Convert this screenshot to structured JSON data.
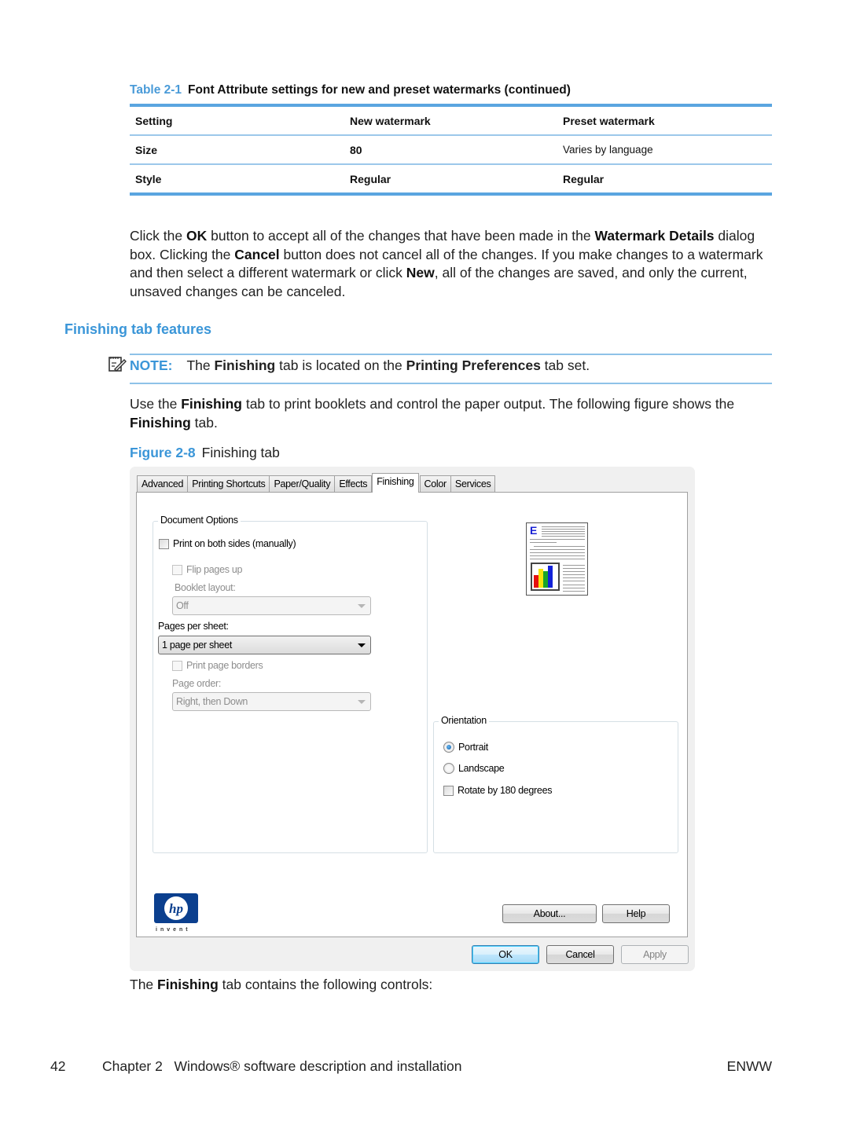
{
  "table": {
    "caption_number": "Table 2-1",
    "caption_title": "Font Attribute settings for new and preset watermarks (continued)",
    "headers": [
      "Setting",
      "New watermark",
      "Preset watermark"
    ],
    "rows": [
      [
        "Size",
        "80",
        "Varies by language"
      ],
      [
        "Style",
        "Regular",
        "Regular"
      ]
    ]
  },
  "paragraph1": {
    "t1": "Click the ",
    "b1": "OK",
    "t2": " button to accept all of the changes that have been made in the ",
    "b2": "Watermark Details",
    "t3": " dialog box. Clicking the ",
    "b3": "Cancel",
    "t4": " button does not cancel all of the changes. If you make changes to a watermark and then select a different watermark or click ",
    "b4": "New",
    "t5": ", all of the changes are saved, and only the current, unsaved changes can be canceled."
  },
  "section": {
    "title": "Finishing tab features"
  },
  "note": {
    "label": "NOTE:",
    "t1": "The ",
    "b1": "Finishing",
    "t2": " tab is located on the ",
    "b2": "Printing Preferences",
    "t3": " tab set."
  },
  "paragraph2": {
    "t1": "Use the ",
    "b1": "Finishing",
    "t2": " tab to print booklets and control the paper output. The following figure shows the ",
    "b2": "Finishing",
    "t3": " tab."
  },
  "figure": {
    "number": "Figure 2-8",
    "title": "Finishing tab"
  },
  "dialog": {
    "tabs": [
      "Advanced",
      "Printing Shortcuts",
      "Paper/Quality",
      "Effects",
      "Finishing",
      "Color",
      "Services"
    ],
    "active_tab": "Finishing",
    "document_options": {
      "title": "Document Options",
      "print_both_sides": {
        "label": "Print on both sides (manually)",
        "checked": false
      },
      "flip_pages_up": {
        "label": "Flip pages up",
        "checked": false,
        "enabled": false
      },
      "booklet_layout_label": "Booklet layout:",
      "booklet_layout_value": "Off",
      "pages_per_sheet_label": "Pages per sheet:",
      "pages_per_sheet_value": "1 page per sheet",
      "print_page_borders": {
        "label": "Print page borders",
        "checked": false,
        "enabled": false
      },
      "page_order_label": "Page order:",
      "page_order_value": "Right, then Down"
    },
    "orientation": {
      "title": "Orientation",
      "portrait": {
        "label": "Portrait",
        "selected": true
      },
      "landscape": {
        "label": "Landscape",
        "selected": false
      },
      "rotate_180": {
        "label": "Rotate by 180 degrees",
        "checked": false
      }
    },
    "preview_letter": "E",
    "buttons": {
      "about": "About...",
      "help": "Help",
      "ok": "OK",
      "cancel": "Cancel",
      "apply": "Apply"
    },
    "logo": {
      "brand": "hp",
      "tagline": "invent"
    }
  },
  "paragraph3": {
    "t1": "The ",
    "b1": "Finishing",
    "t2": " tab contains the following controls:"
  },
  "footer": {
    "page_number": "42",
    "chapter": "Chapter 2   Windows® software description and installation",
    "right": "ENWW"
  },
  "colors": {
    "accent_blue": "#3b96d8",
    "table_rule": "#5aa5e0",
    "hp_blue": "#0b3f8e"
  }
}
